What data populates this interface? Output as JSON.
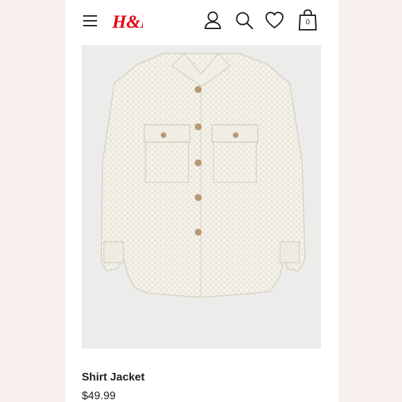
{
  "header": {
    "brand": "H&M",
    "brand_color": "#e50010",
    "icons": [
      "menu-icon",
      "account-icon",
      "search-icon",
      "heart-icon",
      "shopping-bag-icon"
    ],
    "bag_count": "0"
  },
  "product": {
    "title": "Shirt Jacket",
    "price": "$49.99",
    "image_alt": "cream teddy fleece shirt jacket with tan buttons and two chest flap pockets"
  }
}
